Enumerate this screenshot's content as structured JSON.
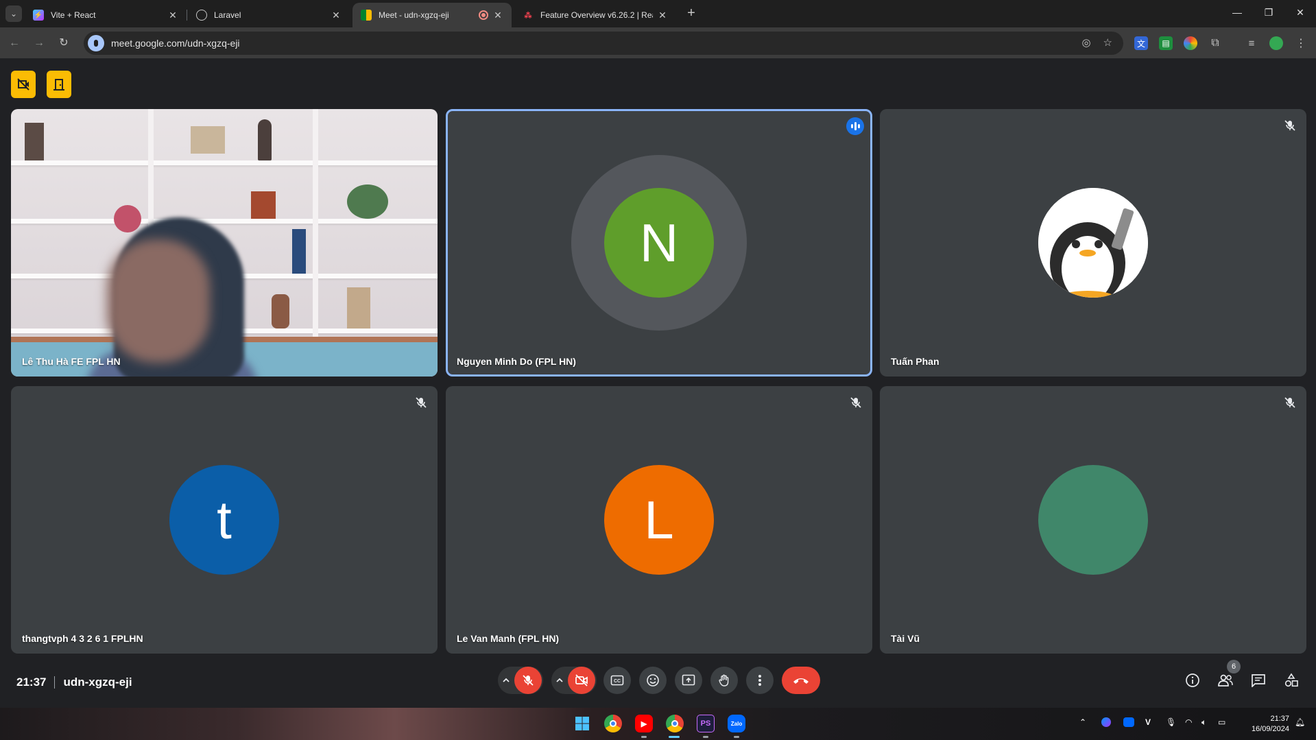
{
  "browser": {
    "tabs": [
      {
        "title": "Vite + React",
        "favicon": "vite-logo"
      },
      {
        "title": "Laravel",
        "favicon": "globe"
      },
      {
        "title": "Meet - udn-xgzq-eji",
        "favicon": "google-meet-logo",
        "active": true,
        "recording_indicator": true
      },
      {
        "title": "Feature Overview v6.26.2 | Reac",
        "favicon": "react-router-logo"
      }
    ],
    "url": "meet.google.com/udn-xgzq-eji"
  },
  "meet": {
    "participants": [
      {
        "name": "Lê Thu Hà FE FPL HN",
        "video_on": true
      },
      {
        "name": "Nguyen Minh Do (FPL HN)",
        "initial": "N",
        "avatar_color": "#5f9e2b",
        "speaking": true
      },
      {
        "name": "Tuấn Phan",
        "avatar_image": "penguin-avatar",
        "muted": true
      },
      {
        "name": "thangtvph 4 3 2 6 1 FPLHN",
        "initial": "t",
        "avatar_color": "#0b5ea8",
        "muted": true
      },
      {
        "name": "Le Van Manh (FPL HN)",
        "initial": "L",
        "avatar_color": "#ee6c00",
        "muted": true
      },
      {
        "name": "Tài Vũ",
        "initial": "",
        "avatar_color": "#40876a",
        "muted": true
      }
    ],
    "time": "21:37",
    "meeting_code": "udn-xgzq-eji",
    "people_count": "6",
    "accent": "#8ab4f8",
    "danger": "#ea4335"
  },
  "taskbar": {
    "time": "21:37",
    "date": "16/09/2024"
  }
}
